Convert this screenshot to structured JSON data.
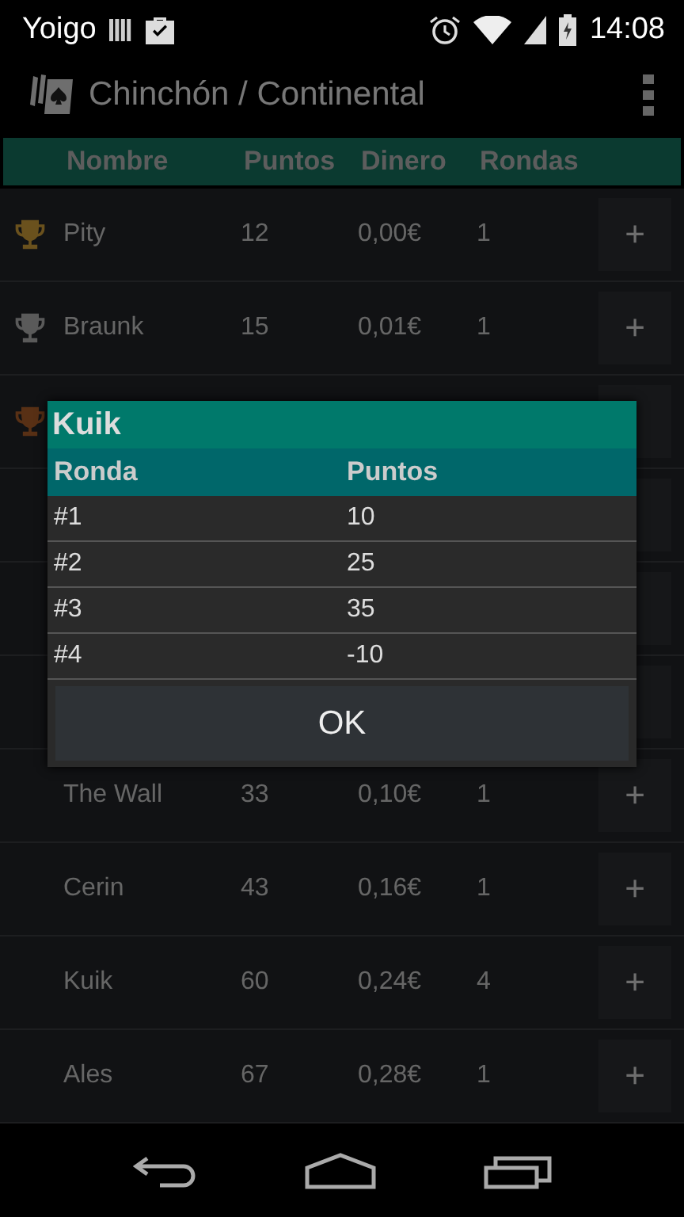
{
  "status_bar": {
    "carrier": "Yoigo",
    "time": "14:08"
  },
  "action_bar": {
    "title": "Chinchón / Continental"
  },
  "table": {
    "columns": [
      "Nombre",
      "Puntos",
      "Dinero",
      "Rondas"
    ],
    "rows": [
      {
        "kind": "player",
        "color": "#6a511d",
        "name": "Pity",
        "puntos": "12",
        "dinero": "0,00€",
        "rondas": "1",
        "add": "+"
      },
      {
        "kind": "player",
        "color": "#5a5a5a",
        "name": "Braunk",
        "puntos": "15",
        "dinero": "0,01€",
        "rondas": "1",
        "add": "+"
      },
      {
        "kind": "covered",
        "color": "#583015"
      },
      {
        "kind": "covered"
      },
      {
        "kind": "covered"
      },
      {
        "kind": "covered"
      },
      {
        "kind": "player",
        "name": "The Wall",
        "puntos": "33",
        "dinero": "0,10€",
        "rondas": "1",
        "add": "+"
      },
      {
        "kind": "player",
        "name": "Cerin",
        "puntos": "43",
        "dinero": "0,16€",
        "rondas": "1",
        "add": "+"
      },
      {
        "kind": "player",
        "name": "Kuik",
        "puntos": "60",
        "dinero": "0,24€",
        "rondas": "4",
        "add": "+"
      },
      {
        "kind": "player",
        "name": "Ales",
        "puntos": "67",
        "dinero": "0,28€",
        "rondas": "1",
        "add": "+"
      }
    ]
  },
  "dialog": {
    "title": "Kuik",
    "columns": [
      "Ronda",
      "Puntos"
    ],
    "rows": [
      {
        "ronda": "#1",
        "puntos": "10"
      },
      {
        "ronda": "#2",
        "puntos": "25"
      },
      {
        "ronda": "#3",
        "puntos": "35"
      },
      {
        "ronda": "#4",
        "puntos": "-10"
      }
    ],
    "button": "OK"
  }
}
